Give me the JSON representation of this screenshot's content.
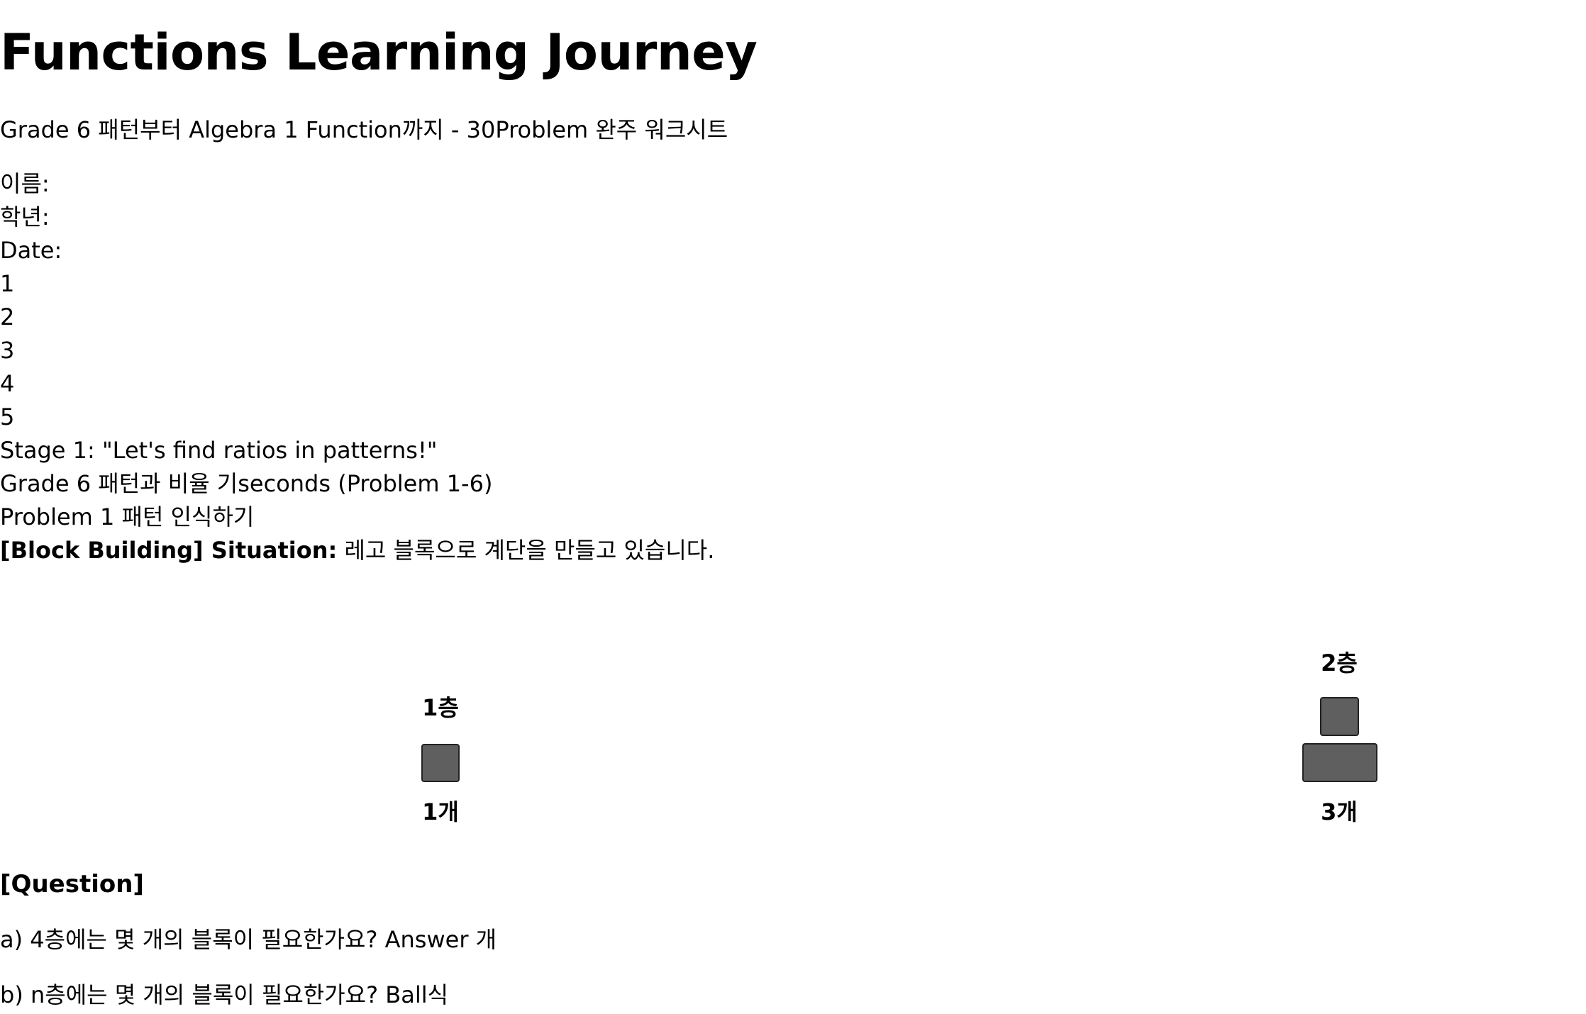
{
  "title": "Functions Learning Journey",
  "subtitle": "Grade 6 패턴부터 Algebra 1 Function까지 - 30Problem 완주 워크시트",
  "fields": {
    "name_label": "이름:",
    "grade_label": "학년:",
    "date_label": "Date:"
  },
  "steps": [
    "1",
    "2",
    "3",
    "4",
    "5"
  ],
  "stage": {
    "title": "Stage 1: \"Let's find ratios in patterns!\"",
    "subtitle": "Grade 6 패턴과 비율 기seconds (Problem 1-6)",
    "problem_title": "Problem 1 패턴 인식하기"
  },
  "situation": {
    "label": "[Block Building] Situation:",
    "text": " 레고 블록으로 계단을 만들고 있습니다."
  },
  "figure": {
    "levels": [
      {
        "level_label": "1층",
        "count_label": "1개",
        "rows": [
          1
        ]
      },
      {
        "level_label": "2층",
        "count_label": "3개",
        "rows": [
          1,
          2
        ]
      }
    ]
  },
  "question": {
    "heading": "[Question]",
    "a": "a) 4층에는 몇 개의 블록이 필요한가요? Answer 개",
    "b": "b) n층에는 몇 개의 블록이 필요한가요? Ball식"
  }
}
